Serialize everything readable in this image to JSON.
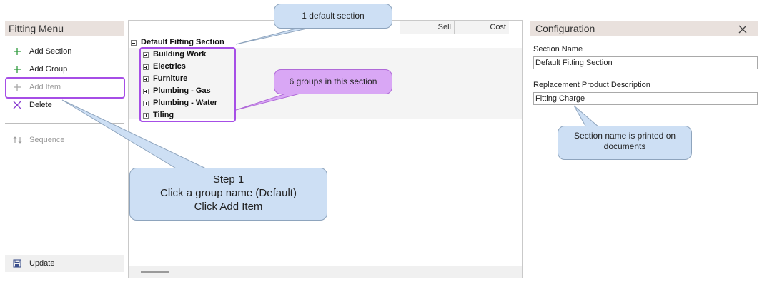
{
  "fitting_menu": {
    "title": "Fitting Menu",
    "items": [
      {
        "label": "Add Section",
        "icon": "plus-icon",
        "enabled": true
      },
      {
        "label": "Add Group",
        "icon": "plus-icon",
        "enabled": true
      },
      {
        "label": "Add Item",
        "icon": "plus-icon",
        "enabled": false
      },
      {
        "label": "Delete",
        "icon": "x-icon",
        "enabled": true
      }
    ],
    "sequence_label": "Sequence",
    "update_label": "Update"
  },
  "tree": {
    "columns": {
      "sell": "Sell",
      "cost": "Cost"
    },
    "section": "Default Fitting Section",
    "groups": [
      "Building Work",
      "Electrics",
      "Furniture",
      "Plumbing - Gas",
      "Plumbing - Water",
      "Tiling"
    ]
  },
  "configuration": {
    "title": "Configuration",
    "section_name_label": "Section Name",
    "section_name_value": "Default Fitting Section",
    "replacement_label": "Replacement Product Description",
    "replacement_value": "Fitting Charge"
  },
  "callouts": {
    "default_section": "1 default section",
    "groups_count": "6 groups in this section",
    "section_name_printed": "Section name is printed on documents",
    "step_title": "Step 1",
    "step_line1": "Click a group name (Default)",
    "step_line2": "Click Add Item"
  },
  "colors": {
    "highlight": "#a64ee6",
    "callout_blue": "#cddff4",
    "callout_purple": "#d9a7f5",
    "header_bg": "#e9e1dd"
  }
}
